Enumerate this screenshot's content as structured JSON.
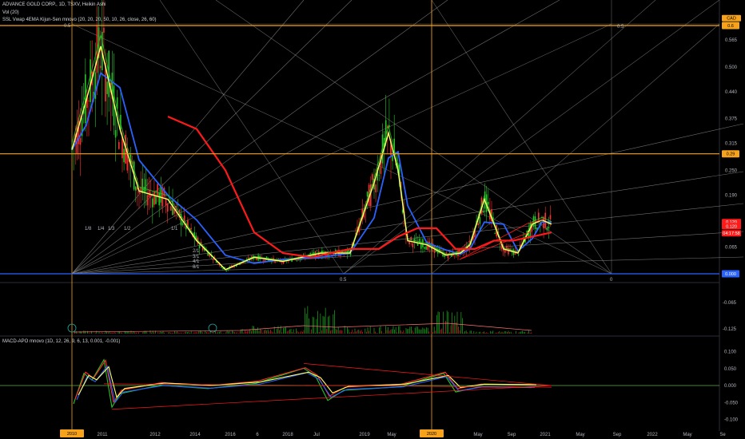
{
  "header": {
    "symbol_line": "ADVANCE GOLD CORP., 1D, TSXV, Heikin Ashi",
    "indicator_1": "Vol (20)",
    "indicator_2": "SSL Vwap 4EMA Kijun-Sen mnovo (20, 20, 20, 50, 10, 26, close, 26, 60)",
    "macd_title": "MACD-APO mnovo (1D, 12, 26, 9, 6, 13, 0.001, -0.001)"
  },
  "colors": {
    "background": "#000000",
    "orange": "#f7a21b",
    "blue": "#2962ff",
    "red": "#ff1a1a",
    "yellow": "#ffff66",
    "green": "#26c426",
    "gann": "#9e9e9e"
  },
  "chart_data": [
    {
      "type": "line",
      "panel": "price",
      "y_axis_labels": [
        "0.565",
        "0.500",
        "0.440",
        "0.375",
        "0.315",
        "0.250",
        "0.190",
        "0.125",
        "0.065",
        "0.000"
      ],
      "y_range": [
        0.0,
        0.62
      ],
      "x_axis_labels": [
        "2011",
        "2012",
        "2014",
        "2016",
        "6",
        "2018",
        "Jul",
        "2019",
        "May",
        "2020",
        "May",
        "Sep",
        "2021",
        "May",
        "Sep",
        "2022",
        "May",
        "Se"
      ],
      "horizontal_levels": [
        {
          "value": 0.6,
          "label": "0.6",
          "color": "#f7a21b"
        },
        {
          "value": 0.29,
          "label": "0.29",
          "color": "#f7a21b"
        },
        {
          "value": 0.0,
          "label": "0.000",
          "color": "#2962ff"
        }
      ],
      "price_badges": [
        {
          "label": "CAD",
          "value": 0.618
        },
        {
          "label": "0.120",
          "value": 0.125
        },
        {
          "label": "0.120",
          "value": 0.115
        },
        {
          "label": "04:17:58",
          "value": 0.098
        }
      ],
      "fan_labels": [
        "1/8",
        "1/4",
        "1/3",
        "1/2",
        "1/1",
        "2/1",
        "3/1",
        "4/1",
        "8/1"
      ],
      "fib_labels": [
        "0.5",
        "0.5",
        "0.5",
        "0"
      ],
      "series": [
        {
          "color": "#ffff66",
          "x": [
            0,
            0.3,
            0.6,
            1,
            1.4,
            2,
            2.6,
            3.2,
            3.8,
            4.4,
            5.2,
            5.8,
            6.3,
            6.6,
            6.8,
            7.0,
            7.4,
            7.8,
            8.1,
            8.3,
            8.6,
            9.0,
            9.3,
            9.6,
            9.8,
            10.0
          ],
          "y": [
            0.3,
            0.42,
            0.55,
            0.35,
            0.2,
            0.18,
            0.08,
            0.01,
            0.04,
            0.03,
            0.05,
            0.05,
            0.22,
            0.34,
            0.25,
            0.08,
            0.07,
            0.045,
            0.05,
            0.07,
            0.18,
            0.06,
            0.05,
            0.12,
            0.13,
            0.12
          ]
        },
        {
          "color": "#ff1a1a",
          "x": [
            2.0,
            2.6,
            3.2,
            3.8,
            4.4,
            5.0,
            5.8,
            6.4,
            6.8,
            7.2,
            7.6,
            8.0,
            8.4,
            8.8,
            9.2,
            9.6,
            10.0
          ],
          "y": [
            0.38,
            0.35,
            0.25,
            0.1,
            0.05,
            0.04,
            0.06,
            0.06,
            0.09,
            0.11,
            0.11,
            0.06,
            0.06,
            0.08,
            0.08,
            0.09,
            0.1
          ]
        }
      ]
    },
    {
      "type": "bar",
      "panel": "volume",
      "y_axis_labels": [
        "-0.065",
        "-0.125"
      ]
    },
    {
      "type": "line",
      "panel": "macd",
      "y_axis_labels": [
        "0.100",
        "0.050",
        "0.000",
        "-0.050",
        "-0.100"
      ],
      "y_range": [
        -0.12,
        0.12
      ],
      "zero_line": 0.0
    }
  ],
  "x_badges": [
    "2010",
    "2020"
  ]
}
